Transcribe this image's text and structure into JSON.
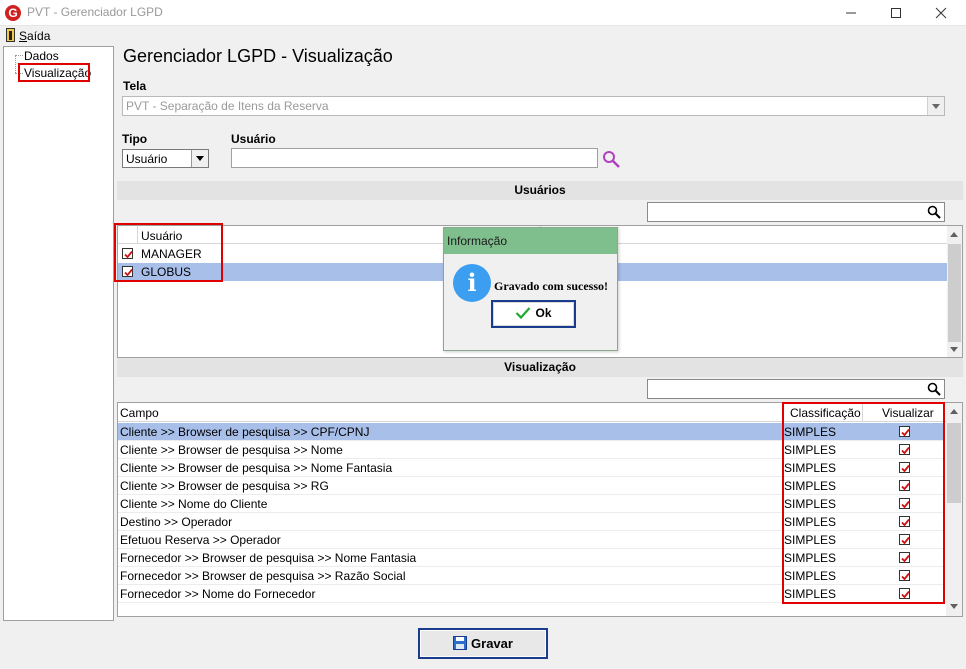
{
  "window": {
    "title": "PVT - Gerenciador LGPD",
    "app_icon_letter": "G"
  },
  "menu": {
    "exit_label": "Saída"
  },
  "tree": {
    "items": [
      {
        "label": "Dados"
      },
      {
        "label": "Visualização",
        "selected": true
      }
    ]
  },
  "page": {
    "title": "Gerenciador LGPD - Visualização",
    "tela_label": "Tela",
    "tela_value": "PVT - Separação de Itens da Reserva",
    "tipo_label": "Tipo",
    "tipo_value": "Usuário",
    "usuario_label": "Usuário",
    "usuario_value": ""
  },
  "users_section": {
    "title": "Usuários",
    "column_usuario": "Usuário",
    "rows": [
      {
        "name": "MANAGER",
        "checked": true
      },
      {
        "name": "GLOBUS",
        "checked": true,
        "selected": true
      }
    ]
  },
  "vis_section": {
    "title": "Visualização",
    "columns": {
      "campo": "Campo",
      "classificacao": "Classificação",
      "visualizar": "Visualizar"
    },
    "rows": [
      {
        "campo": "Cliente >> Browser de pesquisa >> CPF/CPNJ",
        "classificacao": "SIMPLES",
        "visualizar": true,
        "selected": true
      },
      {
        "campo": "Cliente >> Browser de pesquisa >> Nome",
        "classificacao": "SIMPLES",
        "visualizar": true
      },
      {
        "campo": "Cliente >> Browser de pesquisa >> Nome Fantasia",
        "classificacao": "SIMPLES",
        "visualizar": true
      },
      {
        "campo": "Cliente >> Browser de pesquisa >> RG",
        "classificacao": "SIMPLES",
        "visualizar": true
      },
      {
        "campo": "Cliente >> Nome do Cliente",
        "classificacao": "SIMPLES",
        "visualizar": true
      },
      {
        "campo": "Destino >> Operador",
        "classificacao": "SIMPLES",
        "visualizar": true
      },
      {
        "campo": "Efetuou Reserva >> Operador",
        "classificacao": "SIMPLES",
        "visualizar": true
      },
      {
        "campo": "Fornecedor >> Browser de pesquisa >> Nome Fantasia",
        "classificacao": "SIMPLES",
        "visualizar": true
      },
      {
        "campo": "Fornecedor >> Browser de pesquisa >> Razão Social",
        "classificacao": "SIMPLES",
        "visualizar": true
      },
      {
        "campo": "Fornecedor >> Nome do Fornecedor",
        "classificacao": "SIMPLES",
        "visualizar": true
      }
    ]
  },
  "save_button": {
    "label": "Gravar"
  },
  "dialog": {
    "title": "Informação",
    "message": "Gravado com sucesso!",
    "ok_label": "Ok"
  },
  "colors": {
    "selection": "#a8bfea",
    "highlight_red": "#e00000",
    "dialog_title": "#7fbf8e",
    "info_icon": "#3b9ef0",
    "check_red": "#d01010"
  }
}
